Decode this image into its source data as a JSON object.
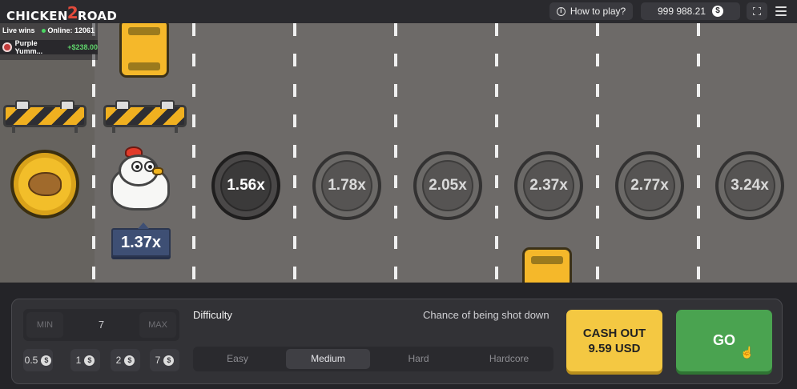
{
  "header": {
    "logo_left": "CHICKEN",
    "logo_num": "2",
    "logo_right": "ROAD",
    "howto_label": "How to play?",
    "balance": "999 988.21",
    "currency_symbol": "$"
  },
  "live": {
    "label": "Live wins",
    "online": "Online: 12061",
    "recent_win": {
      "player": "Purple Yumm...",
      "amount": "+$238.00"
    }
  },
  "game": {
    "current_multiplier": "1.37x",
    "multipliers": [
      "1.56x",
      "1.78x",
      "2.05x",
      "2.37x",
      "2.77x",
      "3.24x"
    ]
  },
  "bet": {
    "min_label": "MIN",
    "max_label": "MAX",
    "value": "7",
    "quick_amounts": [
      "0.5",
      "1",
      "2",
      "7"
    ],
    "quick_symbol": "$"
  },
  "difficulty": {
    "label": "Difficulty",
    "chance_label": "Chance of being shot down",
    "options": [
      "Easy",
      "Medium",
      "Hard",
      "Hardcore"
    ],
    "selected": "Medium"
  },
  "actions": {
    "cashout_line1": "CASH OUT",
    "cashout_line2": "9.59 USD",
    "go_label": "GO"
  },
  "colors": {
    "road": "#6d6a68",
    "cashout": "#f4c842",
    "go": "#4aa350",
    "multiplier_tag": "#3e4f74"
  }
}
